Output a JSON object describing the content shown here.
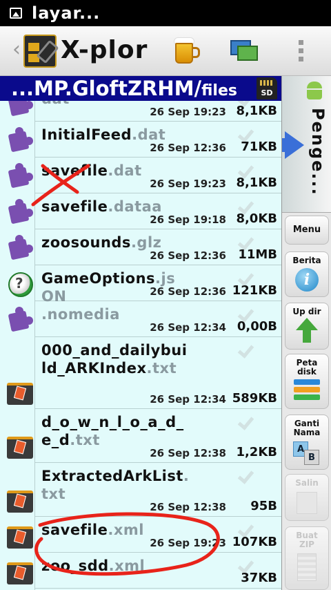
{
  "status_bar": {
    "title": "layar..."
  },
  "action_bar": {
    "app_name": "X-plore"
  },
  "path_bar": {
    "path": "...MP.GloftZRHM/",
    "tail": "files",
    "sd_label": "SD"
  },
  "files": [
    {
      "name": "",
      "ext": "dat",
      "date": "26 Sep 19:23",
      "size": "8,1KB",
      "icon": "puzzle-icon"
    },
    {
      "name": "InitialFeed",
      "ext": ".dat",
      "date": "26 Sep 12:36",
      "size": "71KB",
      "icon": "puzzle-icon"
    },
    {
      "name": "savefile",
      "ext": ".dat",
      "date": "26 Sep 19:23",
      "size": "8,1KB",
      "icon": "puzzle-icon"
    },
    {
      "name": "savefile",
      "ext": ".dataa",
      "date": "26 Sep 19:18",
      "size": "8,0KB",
      "icon": "puzzle-icon"
    },
    {
      "name": "zoosounds",
      "ext": ".glz",
      "date": "26 Sep 12:36",
      "size": "11MB",
      "icon": "puzzle-icon"
    },
    {
      "name": "GameOptions",
      "ext": ".js",
      "extra": "ON",
      "date": "26 Sep 12:36",
      "size": "121KB",
      "icon": "gear-question-icon"
    },
    {
      "name": "",
      "ext": ".nomedia",
      "date": "26 Sep 12:34",
      "size": "0,00B",
      "icon": "puzzle-icon"
    },
    {
      "name": "000_and_dailybuild_ARKIndex",
      "ext": ".txt",
      "date": "26 Sep 12:34",
      "size": "589KB",
      "icon": "document-folder-icon"
    },
    {
      "name": "d_o_w_n_l_o_a_d_e_d",
      "ext": ".txt",
      "date": "26 Sep 12:38",
      "size": "1,2KB",
      "icon": "document-folder-icon"
    },
    {
      "name": "ExtractedArkList",
      "ext": ".txt",
      "date": "26 Sep 12:38",
      "size": "95B",
      "icon": "document-folder-icon"
    },
    {
      "name": "savefile",
      "ext": ".xml",
      "date": "26 Sep 19:23",
      "size": "107KB",
      "icon": "document-folder-icon"
    },
    {
      "name": "zoo_sdd",
      "ext": ".xml",
      "date": "",
      "size": "37KB",
      "icon": "document-folder-icon"
    }
  ],
  "drawer": {
    "label": "Penge..."
  },
  "side_buttons": {
    "menu": "Menu",
    "info": "Berita",
    "updir": "Up dir",
    "disk_line1": "Peta",
    "disk_line2": "disk",
    "rename_line1": "Ganti",
    "rename_line2": "Nama",
    "copy": "Salin",
    "zip_line1": "Buat",
    "zip_line2": "ZIP"
  },
  "colors": {
    "path_bar": "#0a0a8c",
    "list_bg": "#e2fbfb",
    "annotation_red": "#e8231a",
    "puzzle": "#7a4fb0"
  }
}
